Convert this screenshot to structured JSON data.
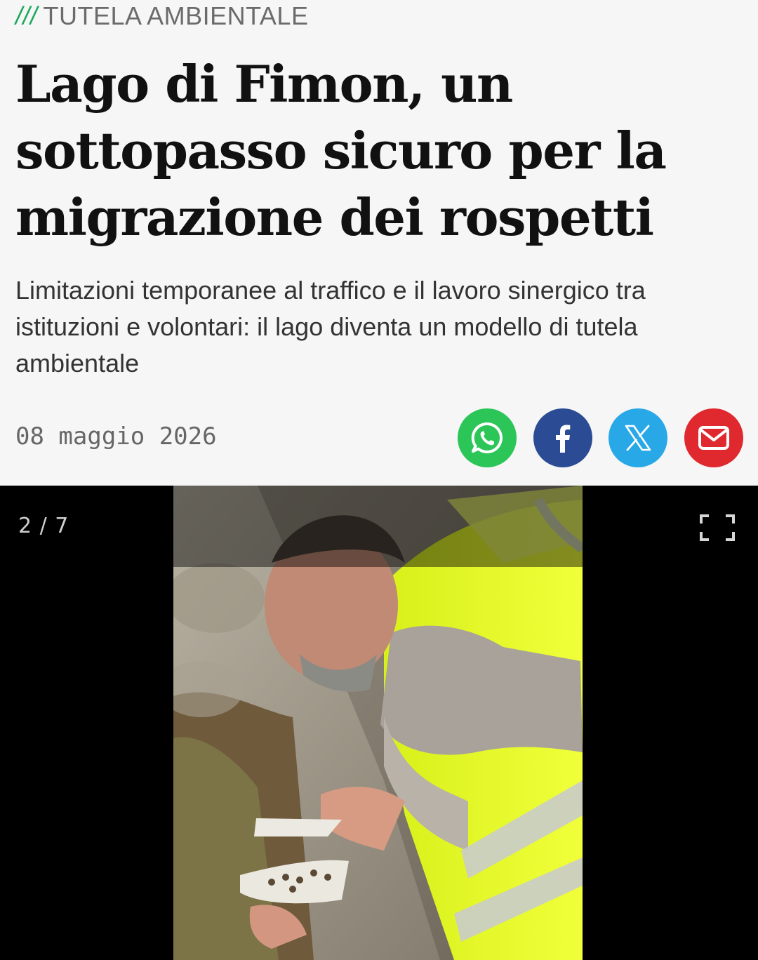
{
  "article": {
    "kicker_mark": "///",
    "kicker": "TUTELA AMBIENTALE",
    "title": "Lago di Fimon, un sottopasso sicuro per la migrazione dei rospetti",
    "subtitle": "Limitazioni temporanee al traffico e il lavoro sinergico tra istituzioni e volontari: il lago diventa un modello di tutela ambientale",
    "date": "08 maggio 2026"
  },
  "share": {
    "buttons": [
      {
        "name": "whatsapp",
        "icon": "whatsapp-icon",
        "color": "#2cc558"
      },
      {
        "name": "facebook",
        "icon": "facebook-icon",
        "color": "#2b4c94"
      },
      {
        "name": "x",
        "icon": "x-icon",
        "color": "#29a8e8"
      },
      {
        "name": "email",
        "icon": "mail-icon",
        "color": "#e0282f"
      }
    ]
  },
  "gallery": {
    "counter": "2 / 7",
    "fullscreen_icon": "fullscreen-icon",
    "photo_alt": "Volunteer in yellow high-visibility vest collecting small toads with a dustpan and brush beside a stone wall"
  },
  "colors": {
    "accent": "#1aa85a",
    "background": "#f6f6f6",
    "gallery_background": "#000000"
  }
}
